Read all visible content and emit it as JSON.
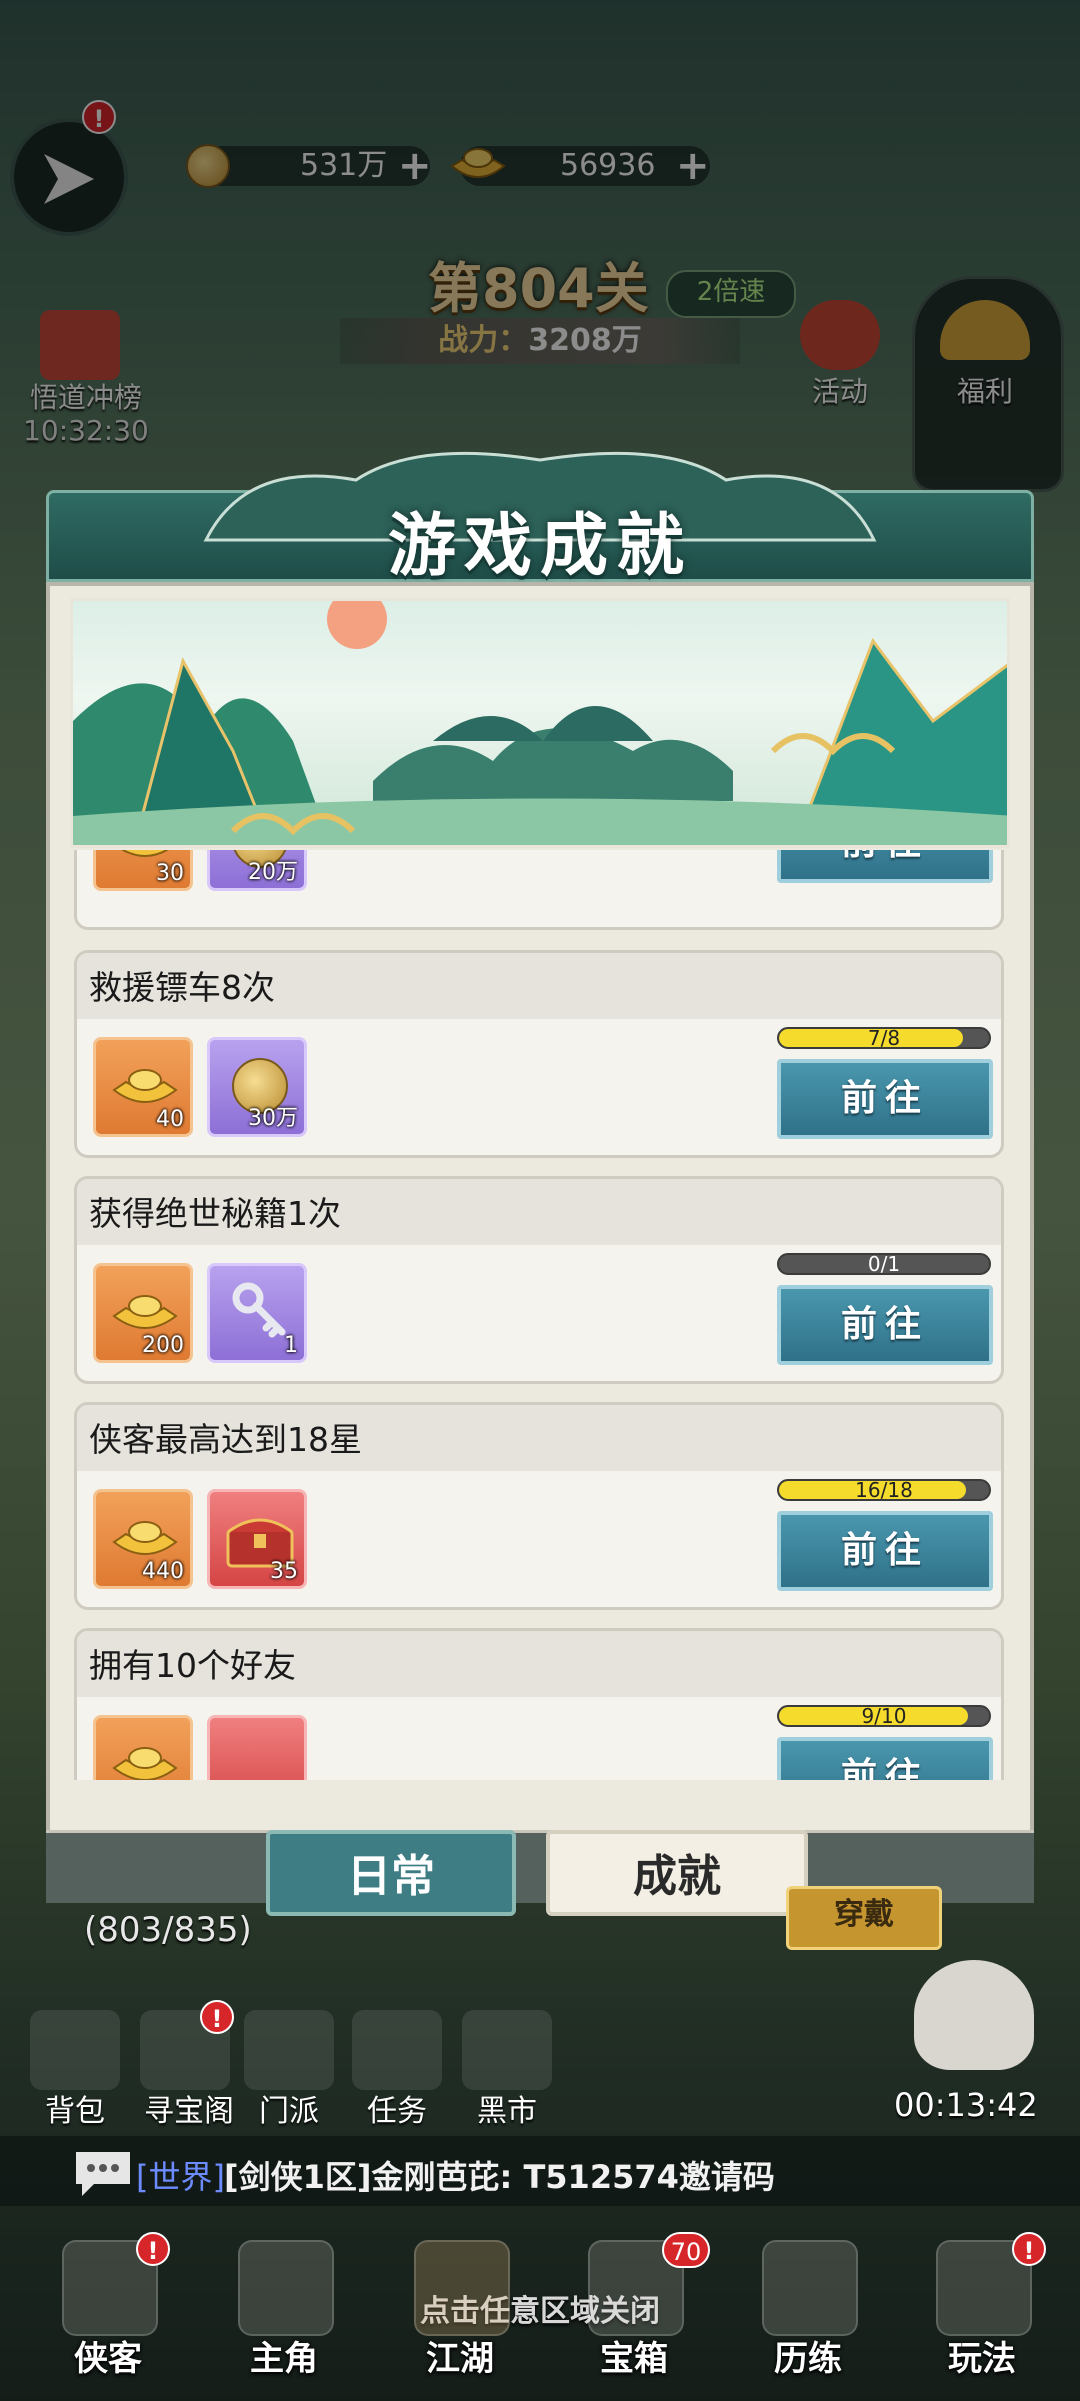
{
  "top": {
    "copper": "531万",
    "gold": "56936",
    "stage": "第804关",
    "speed": "2倍速",
    "power_label": "战力：",
    "power_value": "3208万",
    "rank_label": "悟道冲榜",
    "rank_timer": "10:32:30",
    "activity_label": "活动",
    "welfare_label": "福利"
  },
  "dialog": {
    "title": "游戏成就",
    "go_label": "前往",
    "tabs": {
      "daily": "日常",
      "achievement": "成就"
    }
  },
  "cards": [
    {
      "title": "",
      "r1": "30",
      "r2": "20万",
      "progress_text": "",
      "progress": null
    },
    {
      "title": "救援镖车8次",
      "r1": "40",
      "r2": "30万",
      "progress_text": "7/8",
      "progress": 0.875
    },
    {
      "title": "获得绝世秘籍1次",
      "r1": "200",
      "r2": "1",
      "progress_text": "0/1",
      "progress": 0.0
    },
    {
      "title": "侠客最高达到18星",
      "r1": "440",
      "r2": "35",
      "progress_text": "16/18",
      "progress": 0.889
    },
    {
      "title": "拥有10个好友",
      "r1": "",
      "r2": "",
      "progress_text": "9/10",
      "progress": 0.9
    }
  ],
  "behind": {
    "mainline": "(803/835)",
    "equip": "穿戴",
    "timer": "00:13:42"
  },
  "toolbar": [
    {
      "label": "背包"
    },
    {
      "label": "寻宝阁"
    },
    {
      "label": "门派"
    },
    {
      "label": "任务"
    },
    {
      "label": "黑市"
    }
  ],
  "chat": {
    "channel": "[世界]",
    "text": "[剑侠1区]金刚芭芘: T512574邀请码"
  },
  "close_hint": "点击任意区域关闭",
  "nav": [
    {
      "label": "侠客",
      "badge": "!"
    },
    {
      "label": "主角",
      "badge": ""
    },
    {
      "label": "江湖",
      "badge": ""
    },
    {
      "label": "宝箱",
      "badge": "70"
    },
    {
      "label": "历练",
      "badge": ""
    },
    {
      "label": "玩法",
      "badge": "!"
    }
  ],
  "colors": {
    "accent": "#3d7d83",
    "progress_fill": "#f5dc2c",
    "badge": "#d7262a"
  }
}
